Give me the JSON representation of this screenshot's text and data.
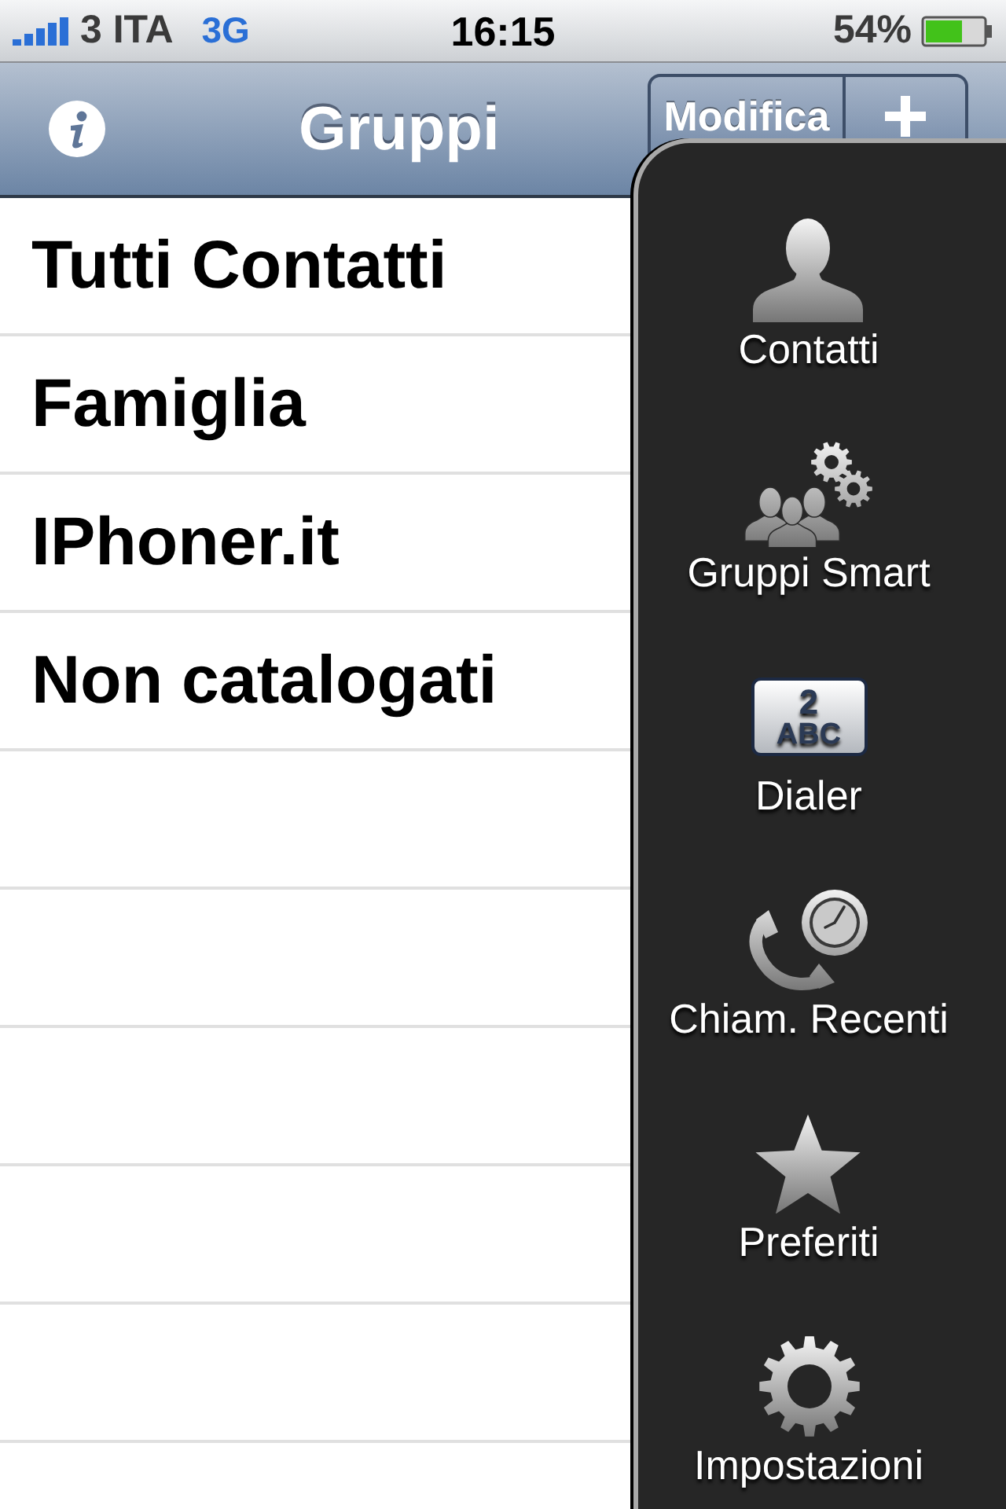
{
  "status_bar": {
    "carrier": "3 ITA",
    "network": "3G",
    "time": "16:15",
    "battery": "54%"
  },
  "nav_bar": {
    "title": "Gruppi",
    "edit_button": "Modifica"
  },
  "groups": [
    {
      "name": "Tutti Contatti"
    },
    {
      "name": "Famiglia"
    },
    {
      "name": "IPhoner.it"
    },
    {
      "name": "Non catalogati"
    }
  ],
  "side_menu": [
    {
      "kind": "contacts",
      "label": "Contatti"
    },
    {
      "kind": "smart_groups",
      "label": "Gruppi Smart"
    },
    {
      "kind": "dialer",
      "label": "Dialer",
      "key_digit": "2",
      "key_letters": "ABC"
    },
    {
      "kind": "recents",
      "label": "Chiam. Recenti"
    },
    {
      "kind": "favorites",
      "label": "Preferiti"
    },
    {
      "kind": "settings",
      "label": "Impostazioni"
    }
  ]
}
